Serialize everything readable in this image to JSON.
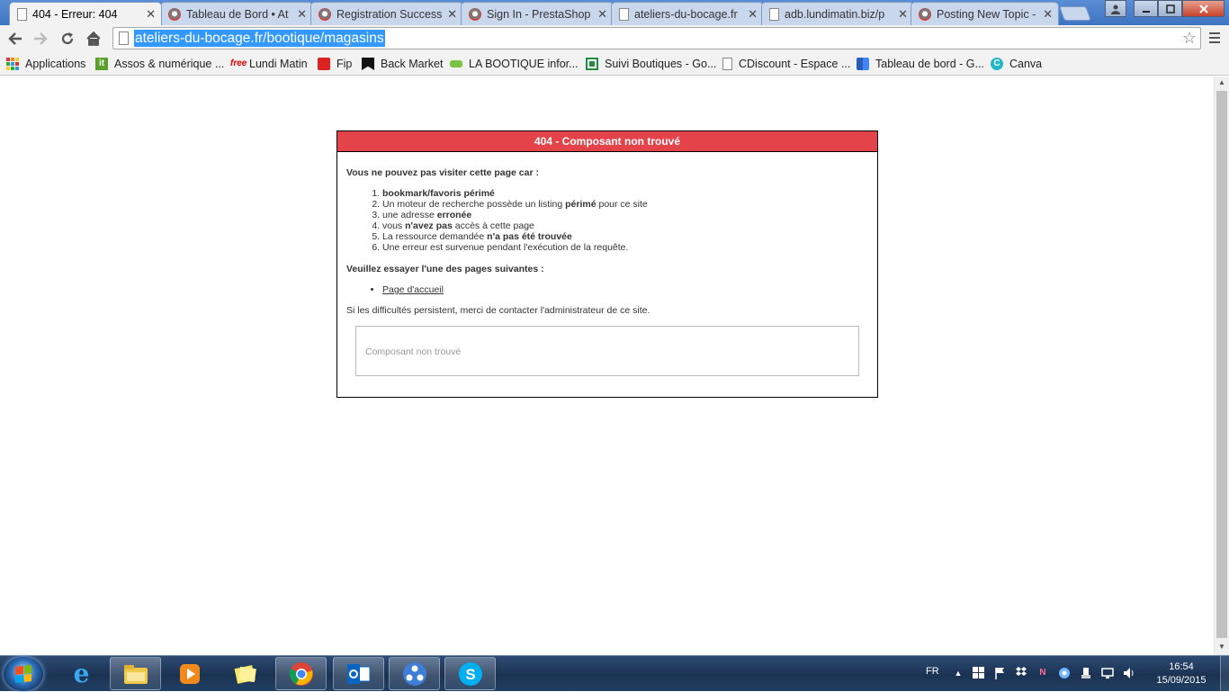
{
  "browser": {
    "tabs": [
      {
        "title": "404 - Erreur: 404",
        "favicon": "page-icon",
        "active": true
      },
      {
        "title": "Tableau de Bord • At",
        "favicon": "forum-icon",
        "active": false
      },
      {
        "title": "Registration Success",
        "favicon": "forum-icon",
        "active": false
      },
      {
        "title": "Sign In - PrestaShop",
        "favicon": "forum-icon",
        "active": false
      },
      {
        "title": "ateliers-du-bocage.fr",
        "favicon": "page-icon",
        "active": false
      },
      {
        "title": "adb.lundimatin.biz/p",
        "favicon": "page-icon",
        "active": false
      },
      {
        "title": "Posting New Topic -",
        "favicon": "forum-icon",
        "active": false
      }
    ],
    "url": "ateliers-du-bocage.fr/bootique/magasins",
    "bookmarks": [
      {
        "label": "Applications",
        "icon": "apps-grid-icon"
      },
      {
        "label": "Assos & numérique ...",
        "icon": "it-icon"
      },
      {
        "label": "Lundi Matin",
        "icon": "free-icon"
      },
      {
        "label": "Fip",
        "icon": "radio-icon"
      },
      {
        "label": "Back Market",
        "icon": "back-market-icon"
      },
      {
        "label": "LA BOOTIQUE infor...",
        "icon": "bootique-icon"
      },
      {
        "label": "Suivi Boutiques - Go...",
        "icon": "sheets-icon"
      },
      {
        "label": "CDiscount - Espace ...",
        "icon": "page-icon"
      },
      {
        "label": "Tableau de bord - G...",
        "icon": "dashboard-icon"
      },
      {
        "label": "Canva",
        "icon": "canva-icon"
      }
    ]
  },
  "error": {
    "header": "404 - Composant non trouvé",
    "lead": "Vous ne pouvez pas visiter cette page car :",
    "reasons": [
      {
        "before": "",
        "bold": "bookmark/favoris périmé",
        "after": ""
      },
      {
        "before": "Un moteur de recherche possède un listing ",
        "bold": "périmé",
        "after": " pour ce site"
      },
      {
        "before": "une adresse ",
        "bold": "erronée",
        "after": ""
      },
      {
        "before": "vous ",
        "bold": "n'avez pas",
        "after": " accès à cette page"
      },
      {
        "before": "La ressource demandée ",
        "bold": "n'a pas été trouvée",
        "after": ""
      },
      {
        "before": "Une erreur est survenue pendant l'exécution de la requête.",
        "bold": "",
        "after": ""
      }
    ],
    "try_heading": "Veuillez essayer l'une des pages suivantes :",
    "pages": [
      "Page d'accueil"
    ],
    "contact": "Si les difficultés persistent, merci de contacter l'administrateur de ce site.",
    "message": "Composant non trouvé"
  },
  "taskbar": {
    "apps": [
      {
        "name": "internet-explorer-icon",
        "open": false
      },
      {
        "name": "file-explorer-icon",
        "open": true
      },
      {
        "name": "media-player-icon",
        "open": false
      },
      {
        "name": "sticky-notes-icon",
        "open": false
      },
      {
        "name": "chrome-icon",
        "open": true
      },
      {
        "name": "outlook-icon",
        "open": true
      },
      {
        "name": "network-app-icon",
        "open": true
      },
      {
        "name": "skype-icon",
        "open": true
      }
    ],
    "language": "FR",
    "time": "16:54",
    "date": "15/09/2015"
  },
  "colors": {
    "error_header": "#e4434a",
    "url_highlight": "#3399ff",
    "taskbar": "#1b3353"
  }
}
